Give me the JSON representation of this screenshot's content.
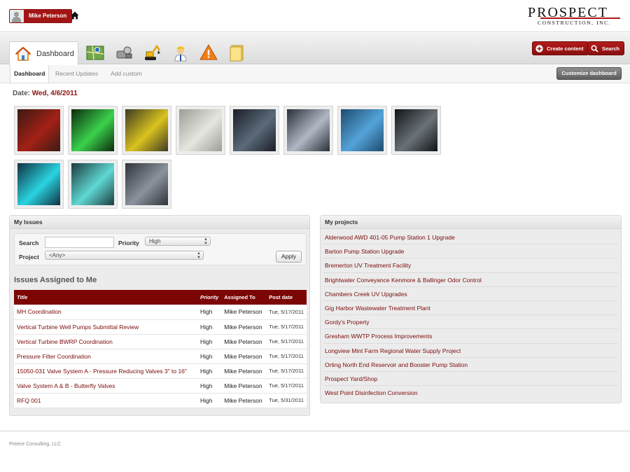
{
  "header": {
    "user_name": "Mike Peterson",
    "logo_line1": "PROSPECT",
    "logo_line2": "CONSTRUCTION, INC."
  },
  "nav": {
    "active_tab": "Dashboard",
    "icons": [
      "map-icon",
      "machinery-icon",
      "excavator-icon",
      "worker-icon",
      "warning-icon",
      "documents-icon"
    ],
    "create_label": "Create content",
    "search_label": "Search"
  },
  "subnav": {
    "tabs": [
      "Dashboard",
      "Recent Updates",
      "Add custom"
    ],
    "customize_label": "Customize dashboard"
  },
  "date": {
    "label": "Date:",
    "value": "Wed, 4/6/2011"
  },
  "gallery": {
    "photos": [
      {
        "name": "photo-valve-red",
        "c1": "#3b1b12",
        "c2": "#a32016"
      },
      {
        "name": "photo-control-screen",
        "c1": "#0b2a0b",
        "c2": "#3bd14c"
      },
      {
        "name": "photo-yellow-equipment",
        "c1": "#3d3a22",
        "c2": "#d9c21f"
      },
      {
        "name": "photo-electrical-panel",
        "c1": "#9b9e96",
        "c2": "#e4e6df"
      },
      {
        "name": "photo-pump-room",
        "c1": "#1a1d25",
        "c2": "#5b6a7a"
      },
      {
        "name": "photo-piping",
        "c1": "#2a2f38",
        "c2": "#b0b8c4"
      },
      {
        "name": "photo-blue-pump",
        "c1": "#1e4a6e",
        "c2": "#53a3d9"
      },
      {
        "name": "photo-generator",
        "c1": "#111418",
        "c2": "#6a7178"
      },
      {
        "name": "photo-scada-screen-1",
        "c1": "#103040",
        "c2": "#2ad3e0"
      },
      {
        "name": "photo-scada-screen-2",
        "c1": "#1b3a3e",
        "c2": "#5fd8d3"
      },
      {
        "name": "photo-facility-interior",
        "c1": "#30343a",
        "c2": "#8a929c"
      }
    ]
  },
  "issues": {
    "panel_title": "My Issues",
    "filters": {
      "search_label": "Search",
      "search_value": "",
      "priority_label": "Priority",
      "priority_value": "High",
      "project_label": "Project",
      "project_value": "<Any>",
      "apply_label": "Apply"
    },
    "assigned_title": "Issues Assigned to Me",
    "columns": [
      "Title",
      "Priority",
      "Assigned To",
      "Post date"
    ],
    "rows": [
      {
        "title": "MH Coordination",
        "priority": "High",
        "assigned": "Mike Peterson",
        "date": "Tue, 5/17/2011"
      },
      {
        "title": "Vertical Turbine Well Pumps Submittal Review",
        "priority": "High",
        "assigned": "Mike Peterson",
        "date": "Tue, 5/17/2011"
      },
      {
        "title": "Vertical Turbine BWRP Coordination",
        "priority": "High",
        "assigned": "Mike Peterson",
        "date": "Tue, 5/17/2011"
      },
      {
        "title": "Pressure Filter Coordination",
        "priority": "High",
        "assigned": "Mike Peterson",
        "date": "Tue, 5/17/2011"
      },
      {
        "title": "15050-031 Valve System A - Pressure Reducing Valves 3\" to 16\"",
        "priority": "High",
        "assigned": "Mike Peterson",
        "date": "Tue, 5/17/2011"
      },
      {
        "title": "Valve System A & B - Butterfly Valves",
        "priority": "High",
        "assigned": "Mike Peterson",
        "date": "Tue, 5/17/2011"
      },
      {
        "title": "RFQ 001",
        "priority": "High",
        "assigned": "Mike Peterson",
        "date": "Tue, 5/31/2011"
      }
    ]
  },
  "projects": {
    "panel_title": "My projects",
    "items": [
      "Alderwood AWD 401-05 Pump Station 1 Upgrade",
      "Barton Pump Station Upgrade",
      "Bremerton UV Treatment Facility",
      "Brightwater Conveyance Kenmore & Ballinger Odor Control",
      "Chambers Creek UV Upgrades",
      "Gig Harbor Wastewater Treatment Plant",
      "Gordy's Property",
      "Gresham WWTP Process Improvements",
      "Longview Mint Farm Regional Water Supply Project",
      "Orting North End Reservoir and Booster Pump Station",
      "Prospect Yard/Shop",
      "West Point Disinfection Conversion"
    ]
  },
  "footer": {
    "text": "Preece Consulting, LLC"
  },
  "colors": {
    "brand_red": "#a31515",
    "table_header": "#7c0606",
    "link_text": "#7a0a0a"
  }
}
